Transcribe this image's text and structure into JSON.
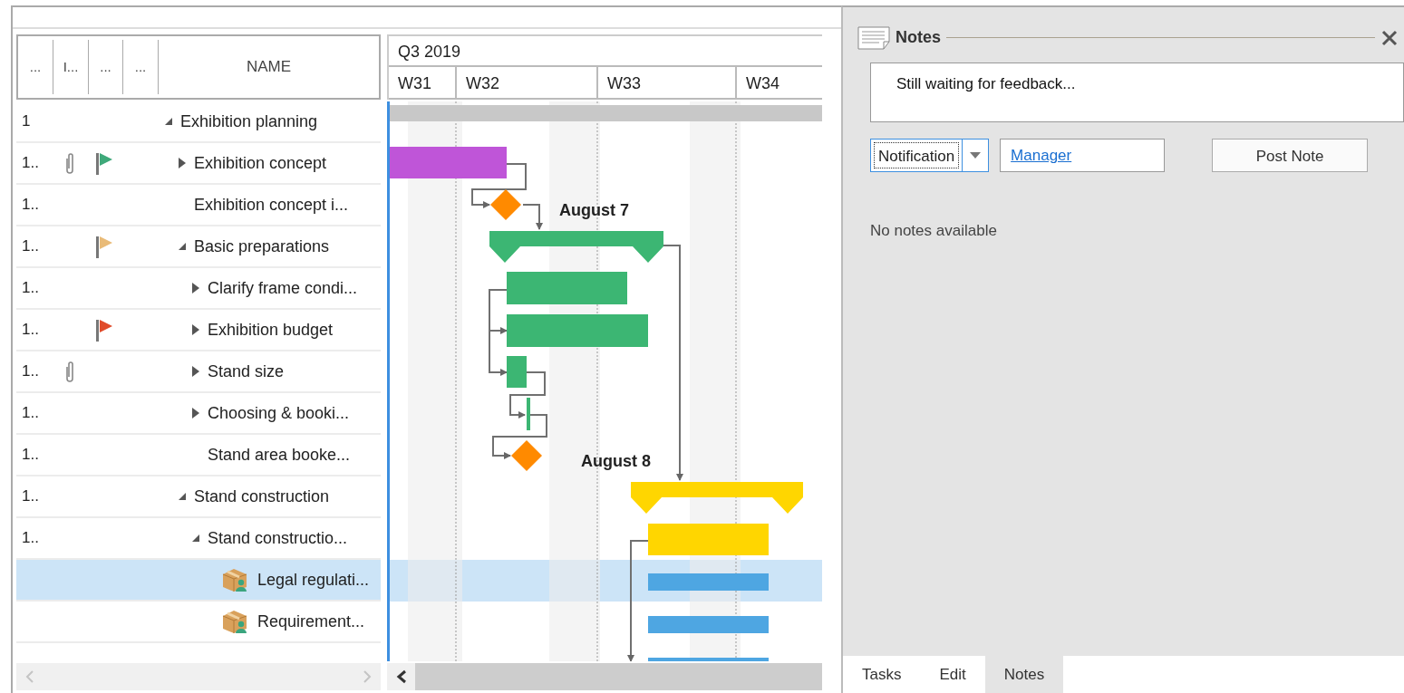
{
  "table": {
    "columns": [
      "...",
      "I...",
      "...",
      "...",
      "NAME"
    ],
    "rows": [
      {
        "id": "1",
        "name": "Exhibition planning",
        "kind": "group",
        "expanded": true,
        "attachment": false,
        "selected": false,
        "children": [
          {
            "id": "1..",
            "name": "Exhibition concept",
            "kind": "group",
            "expanded": false,
            "attachment": true,
            "color": "#3fa97a",
            "selected": false
          },
          {
            "id": "1..",
            "name": "Exhibition concept i...",
            "kind": "milestone",
            "attachment": false,
            "selected": false
          },
          {
            "id": "1..",
            "name": "Basic preparations",
            "kind": "group",
            "expanded": true,
            "attachment": false,
            "color": "#e9bb78",
            "selected": false,
            "children": [
              {
                "id": "1..",
                "name": "Clarify frame condi...",
                "kind": "group",
                "expanded": false,
                "attachment": false,
                "selected": false
              },
              {
                "id": "1..",
                "name": "Exhibition budget",
                "kind": "group",
                "expanded": false,
                "attachment": false,
                "color": "#e04b2a",
                "selected": false
              },
              {
                "id": "1..",
                "name": "Stand size",
                "kind": "group",
                "expanded": false,
                "attachment": true,
                "selected": false
              },
              {
                "id": "1..",
                "name": "Choosing & booki...",
                "kind": "group",
                "expanded": false,
                "attachment": false,
                "selected": false
              },
              {
                "id": "1..",
                "name": "Stand area booke...",
                "kind": "milestone",
                "attachment": false,
                "selected": false
              }
            ]
          },
          {
            "id": "1..",
            "name": "Stand construction",
            "kind": "group",
            "expanded": true,
            "attachment": false,
            "selected": false,
            "children": [
              {
                "id": "1..",
                "name": "Stand constructio...",
                "kind": "group",
                "expanded": true,
                "attachment": false,
                "selected": false,
                "children": [
                  {
                    "name": "Legal regulati...",
                    "kind": "assignment",
                    "attachment": false,
                    "selected": true
                  },
                  {
                    "name": "Requirement...",
                    "kind": "assignment",
                    "attachment": false,
                    "selected": false
                  }
                ]
              }
            ]
          }
        ]
      }
    ]
  },
  "timeline": {
    "quarter": "Q3 2019",
    "weeks": [
      "W31",
      "W32",
      "W33",
      "W34"
    ],
    "milestone_labels": [
      "August 7",
      "August 8"
    ]
  },
  "notes_panel": {
    "title": "Notes",
    "note_text": "Still waiting for feedback...",
    "type_select": "Notification",
    "recipient": "Manager",
    "post_button": "Post Note",
    "empty_message": "No notes available"
  },
  "tabs": [
    {
      "label": "Tasks",
      "selected": false
    },
    {
      "label": "Edit",
      "selected": false
    },
    {
      "label": "Notes",
      "selected": true
    }
  ]
}
